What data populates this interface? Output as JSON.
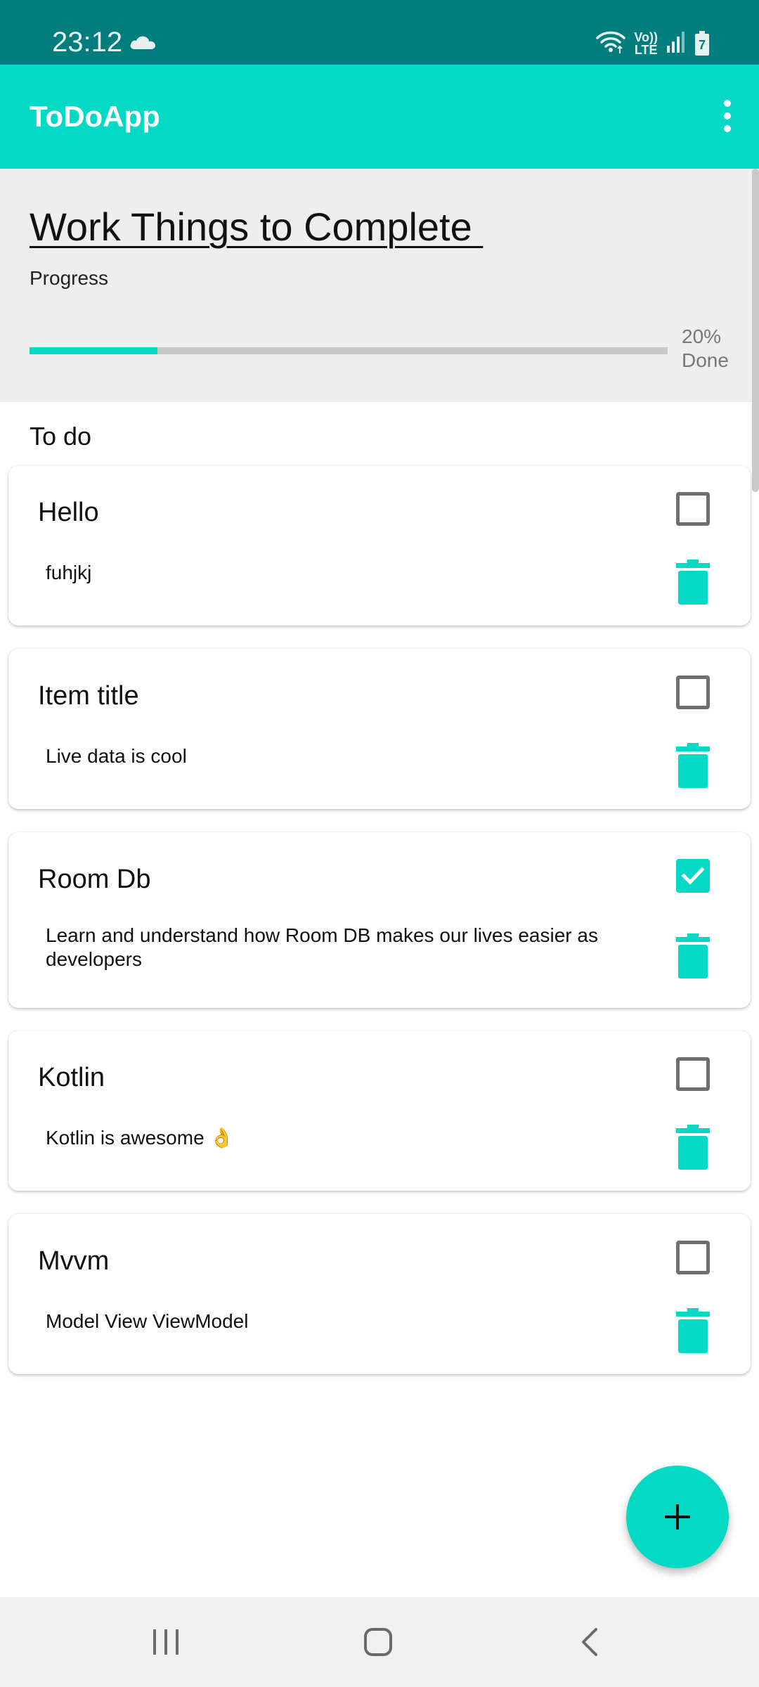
{
  "status_bar": {
    "time": "23:12",
    "network_label_top": "Vo))",
    "network_label_bottom": "LTE",
    "battery_level": "7"
  },
  "app_bar": {
    "title": "ToDoApp"
  },
  "header": {
    "list_title": "Work Things to Complete ",
    "progress_label": "Progress",
    "progress_percent": "20%",
    "progress_done": "Done",
    "progress_fraction": 0.2
  },
  "section": {
    "label": "To do"
  },
  "tasks": [
    {
      "title": "Hello",
      "description": "fuhjkj",
      "checked": false
    },
    {
      "title": "Item title",
      "description": "Live data is cool",
      "checked": false
    },
    {
      "title": "Room Db",
      "description": "Learn and understand how Room DB makes our lives easier as developers",
      "checked": true
    },
    {
      "title": "Kotlin",
      "description": "Kotlin is awesome 👌",
      "checked": false
    },
    {
      "title": "Mvvm",
      "description": "Model View ViewModel",
      "checked": false
    }
  ],
  "colors": {
    "accent": "#03d9c5",
    "status_bar": "#027d7e",
    "header_bg": "#eeeeee"
  },
  "icons": {
    "fab": "plus-icon",
    "delete": "trash-icon",
    "menu": "overflow-menu-icon"
  }
}
